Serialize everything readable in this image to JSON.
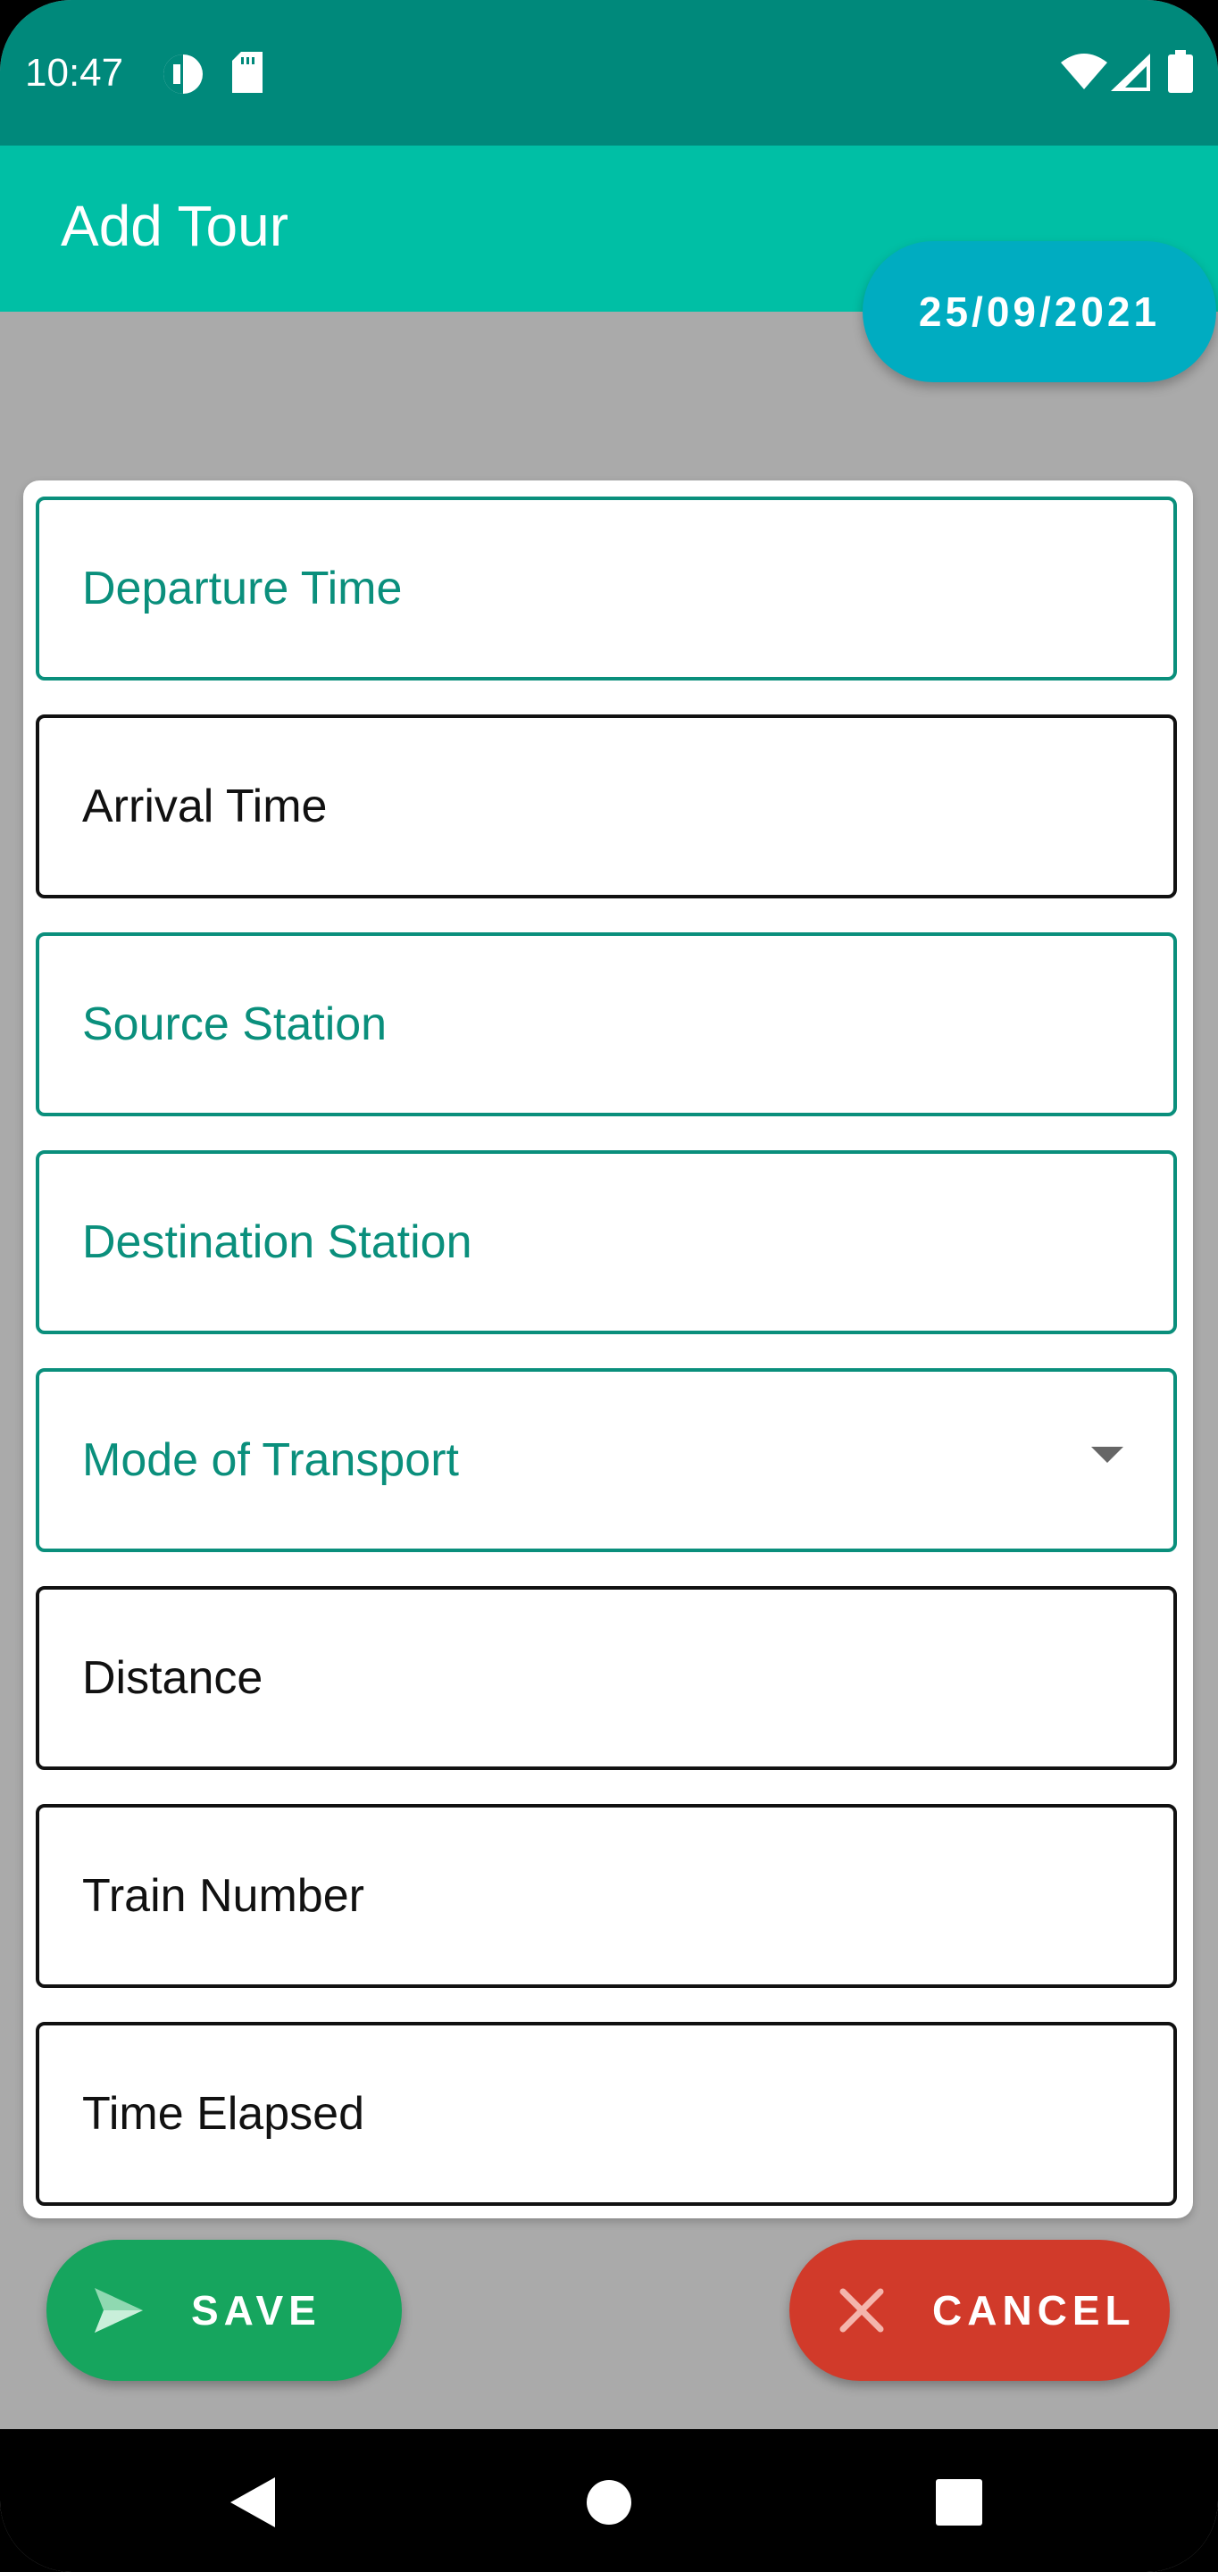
{
  "status_bar": {
    "time": "10:47",
    "icons_left": [
      "data-saver-icon",
      "sd-card-icon"
    ],
    "icons_right": [
      "wifi-icon",
      "signal-icon",
      "battery-icon"
    ]
  },
  "app_bar": {
    "title": "Add Tour"
  },
  "date_chip": {
    "label": "25/09/2021"
  },
  "form": {
    "fields": [
      {
        "label": "Departure Time",
        "state": "focused-accent"
      },
      {
        "label": "Arrival Time",
        "state": "default"
      },
      {
        "label": "Source Station",
        "state": "focused-accent"
      },
      {
        "label": "Destination Station",
        "state": "focused-accent"
      },
      {
        "label": "Mode of Transport",
        "state": "focused-accent",
        "type": "dropdown"
      },
      {
        "label": "Distance",
        "state": "default"
      },
      {
        "label": "Train Number",
        "state": "default"
      },
      {
        "label": "Time Elapsed",
        "state": "default"
      }
    ]
  },
  "actions": {
    "save_label": "SAVE",
    "cancel_label": "CANCEL",
    "save_icon": "send-icon",
    "cancel_icon": "close-icon"
  },
  "nav_bar": {
    "buttons": [
      "back-icon",
      "home-icon",
      "recents-icon"
    ]
  },
  "colors": {
    "status_bar": "#00897b",
    "app_bar": "#00bfa5",
    "date_chip": "#00acc1",
    "accent_text": "#0a8f7c",
    "save": "#16a55e",
    "cancel": "#d13a2a",
    "scrim": "#aaaaaa"
  }
}
